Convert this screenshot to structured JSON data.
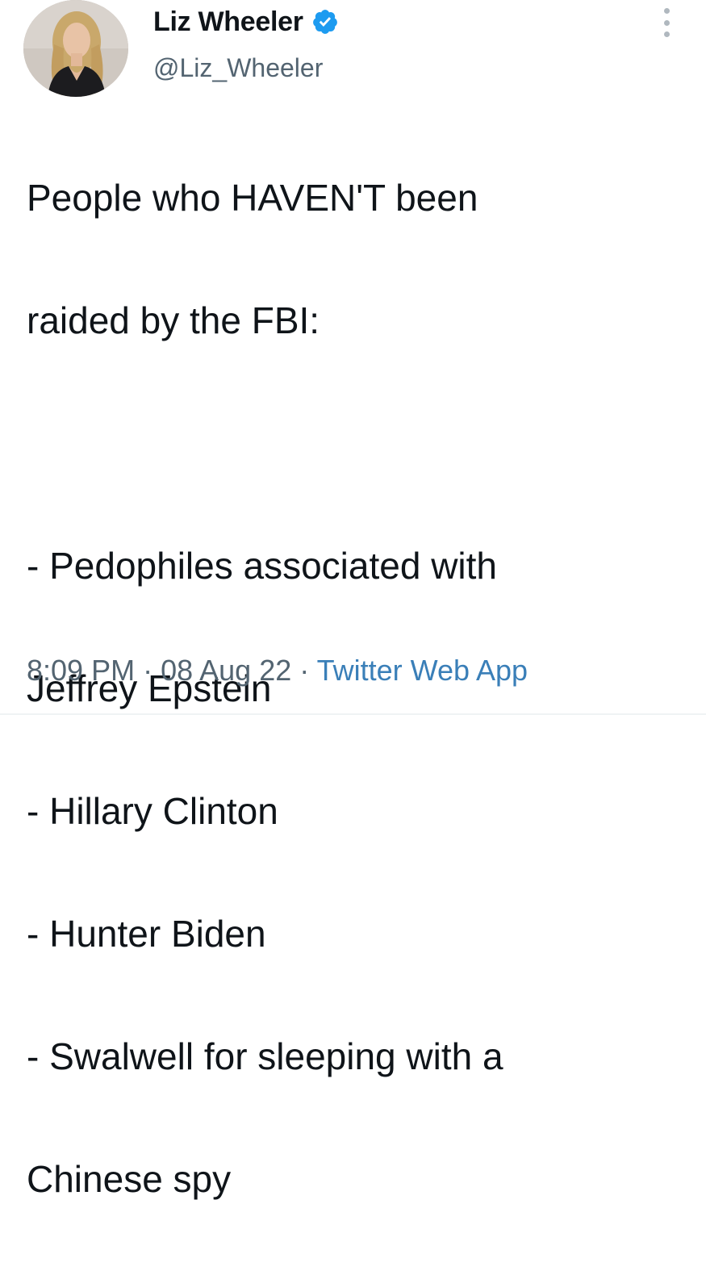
{
  "author": {
    "display_name": "Liz Wheeler",
    "handle": "@Liz_Wheeler",
    "verified": true,
    "avatar_icon": "profile-photo"
  },
  "tweet": {
    "lines": [
      "People who HAVEN'T been",
      "raided by the FBI:",
      "",
      "- Pedophiles associated with",
      "Jeffrey Epstein",
      "- Hillary Clinton",
      "- Hunter Biden",
      "- Swalwell for sleeping with a",
      "Chinese spy"
    ],
    "time": "8:09 PM",
    "separator": " · ",
    "date": "08 Aug 22",
    "source": "Twitter Web App"
  },
  "icons": {
    "verified": "verified-badge-icon",
    "more": "more-options-icon"
  },
  "colors": {
    "text": "#0f1419",
    "secondary": "#536471",
    "verified": "#1d9bf0",
    "link": "#3a7fb8"
  }
}
